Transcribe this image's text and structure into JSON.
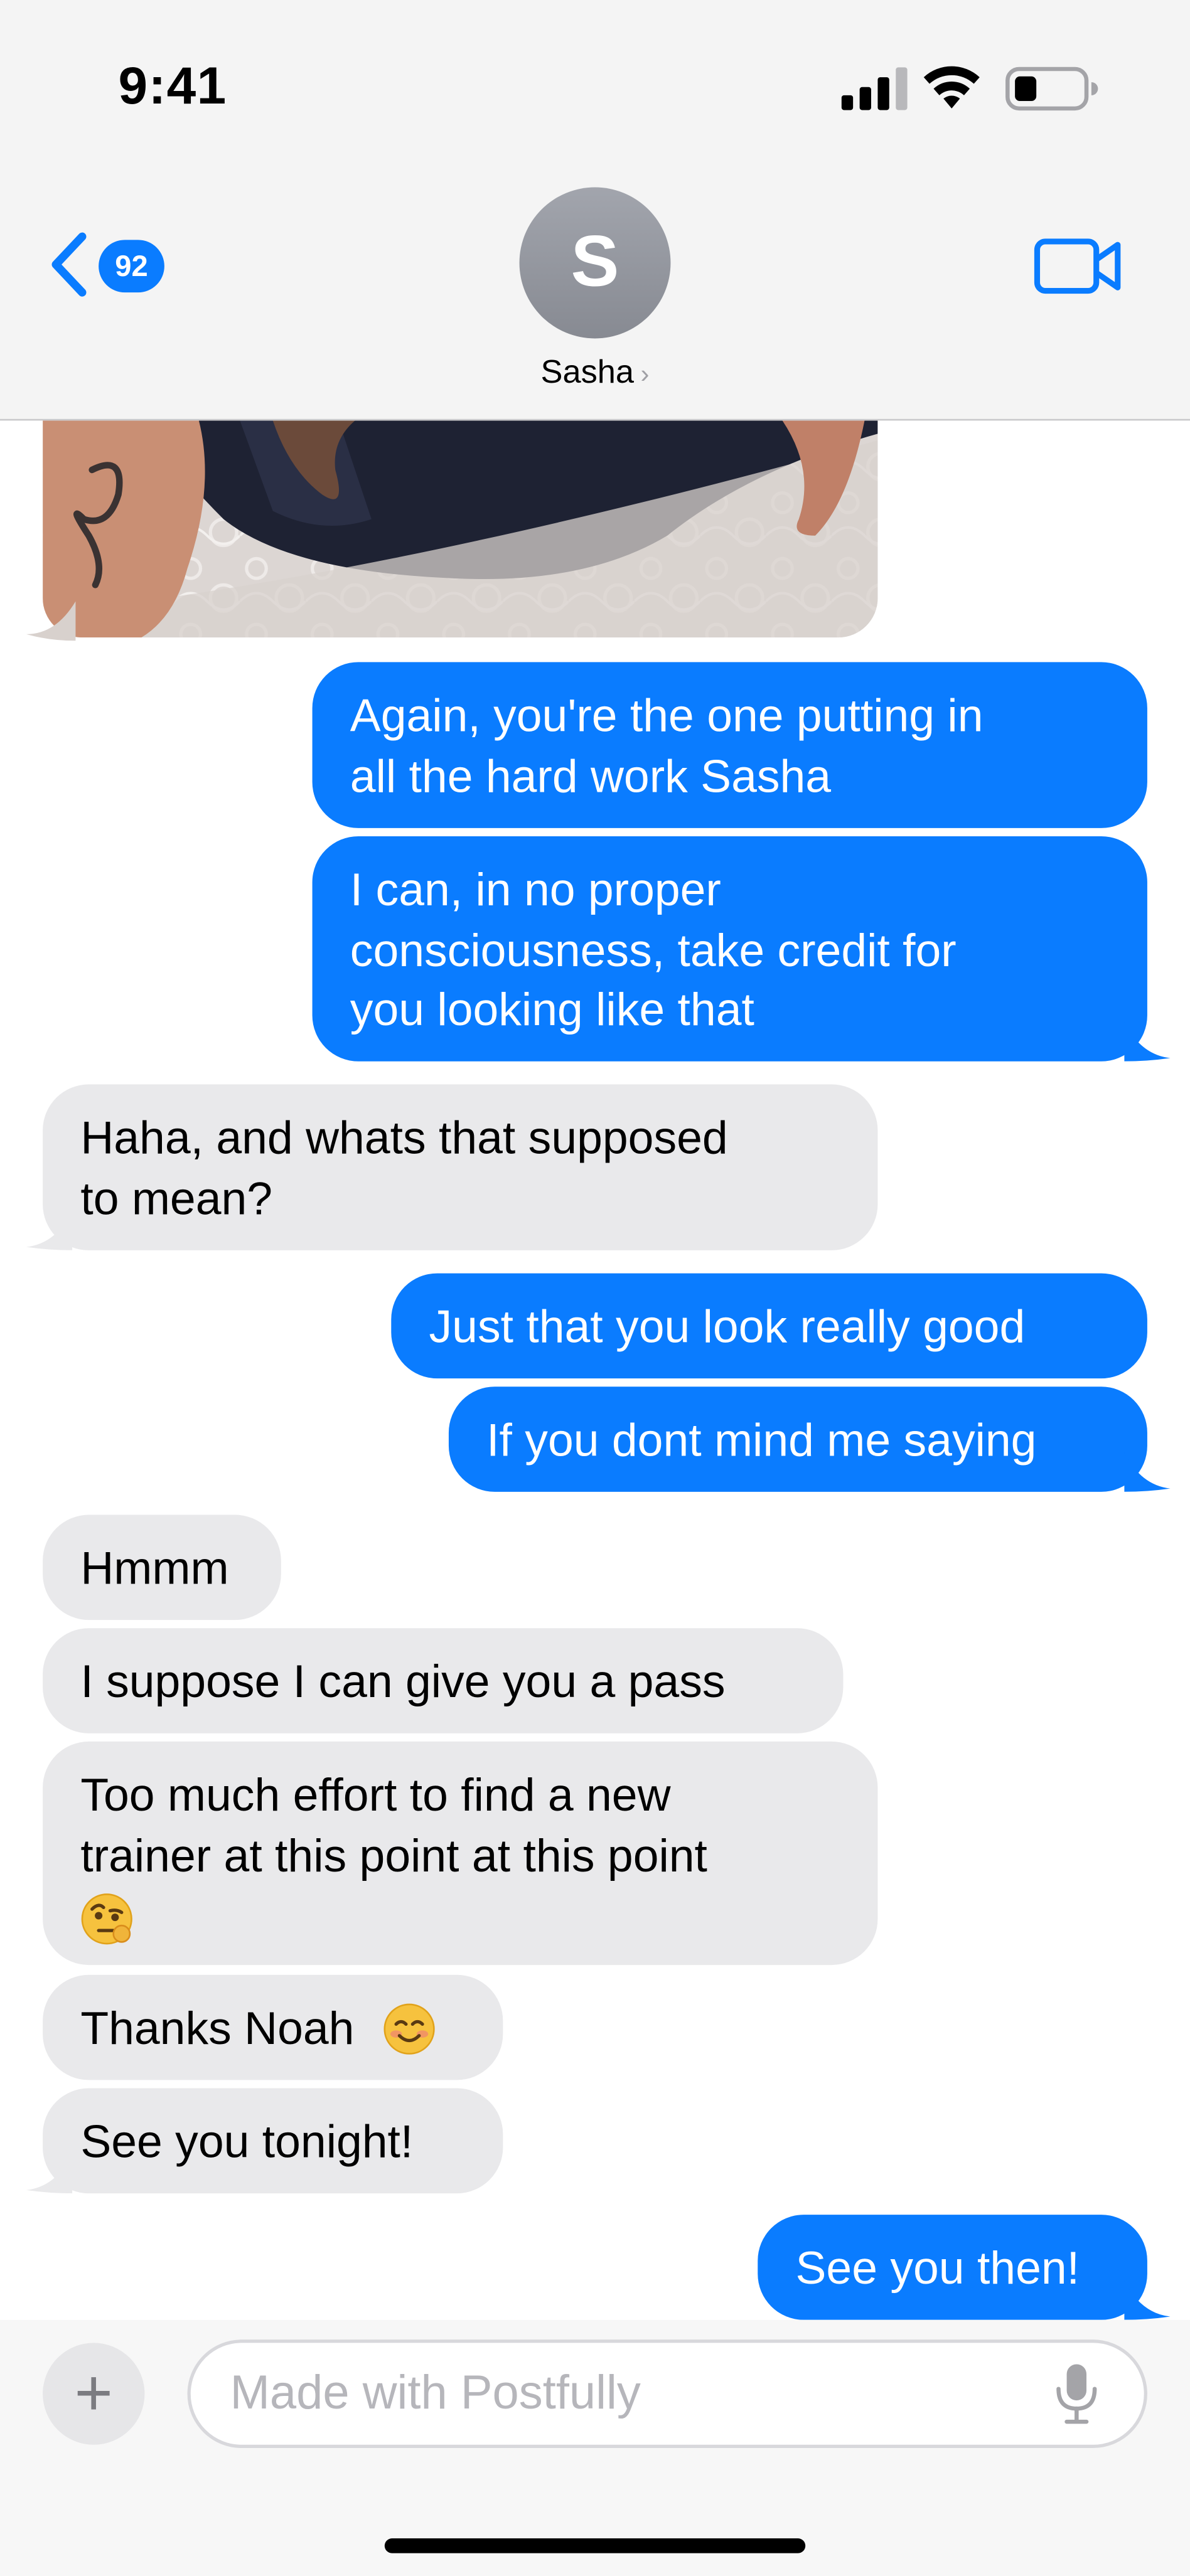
{
  "status_bar": {
    "time": "9:41"
  },
  "header": {
    "back_badge": "92",
    "avatar_initial": "S",
    "contact_name": "Sasha",
    "contact_chevron": "›"
  },
  "colors": {
    "sent_bubble": "#0a7cff",
    "received_bubble": "#e9e9eb",
    "accent": "#0a7cff"
  },
  "messages": [
    {
      "side": "received",
      "type": "photo"
    },
    {
      "side": "sent",
      "lines": [
        "Again, you're the one putting in",
        "all the hard work Sasha"
      ]
    },
    {
      "side": "sent",
      "lines": [
        "I can, in no proper",
        "consciousness, take credit for",
        "you looking like that"
      ]
    },
    {
      "side": "received",
      "lines": [
        "Haha, and whats that supposed",
        "to mean?"
      ]
    },
    {
      "side": "sent",
      "lines": [
        "Just that you look really good"
      ]
    },
    {
      "side": "sent",
      "lines": [
        "If you dont mind me saying"
      ]
    },
    {
      "side": "received",
      "lines": [
        "Hmmm"
      ]
    },
    {
      "side": "received",
      "lines": [
        "I suppose I can give you a pass"
      ]
    },
    {
      "side": "received",
      "lines": [
        "Too much effort to find a new",
        "trainer at this point at this point"
      ],
      "emoji": "face-with-raised-eyebrow-icon"
    },
    {
      "side": "received",
      "lines": [
        "Thanks Noah"
      ],
      "emoji": "smiling-face-icon"
    },
    {
      "side": "received",
      "lines": [
        "See you tonight!"
      ]
    },
    {
      "side": "sent",
      "lines": [
        "See you then!"
      ]
    }
  ],
  "composer": {
    "placeholder": "Made with Postfully",
    "plus_label": "+"
  }
}
